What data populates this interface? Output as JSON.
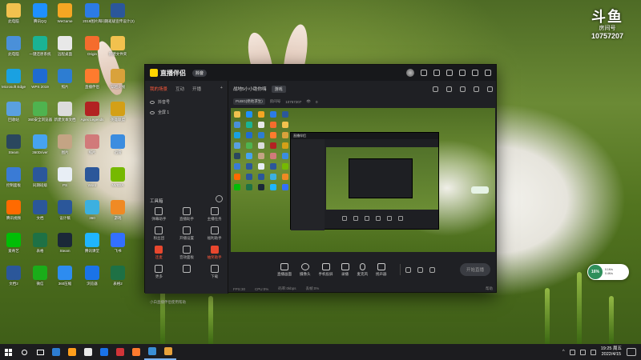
{
  "watermark": {
    "logo": "斗鱼",
    "sub": "房间号",
    "room": "10757207"
  },
  "desktop_icons": [
    {
      "label": "此电脑",
      "color": "#f2c14e"
    },
    {
      "label": "腾讯QQ",
      "color": "#1e90ff"
    },
    {
      "label": "WeGame",
      "color": "#f5a623"
    },
    {
      "label": "2019图片库",
      "color": "#2c7be5"
    },
    {
      "label": "同期班级宣传设计(2)",
      "color": "#2b579a"
    },
    {
      "label": "此电脑",
      "color": "#4a90d9"
    },
    {
      "label": "一键还原系统",
      "color": "#1ab394"
    },
    {
      "label": "远程桌面",
      "color": "#e8e8e8"
    },
    {
      "label": "Origin",
      "color": "#f56c2d"
    },
    {
      "label": "新建文件夹",
      "color": "#f2c14e"
    },
    {
      "label": "Microsoft Edge",
      "color": "#1aa1e1"
    },
    {
      "label": "WPS 2019",
      "color": "#1f6bd1"
    },
    {
      "label": "照片",
      "color": "#2d7dd2"
    },
    {
      "label": "直播伴侣",
      "color": "#ff7b2e"
    },
    {
      "label": "穿越火线",
      "color": "#d9a23b"
    },
    {
      "label": "回收站",
      "color": "#5aa0e0"
    },
    {
      "label": "360安全浏览器",
      "color": "#4fb34f"
    },
    {
      "label": "新建文本文档",
      "color": "#dcdcdc"
    },
    {
      "label": "Apex Legends",
      "color": "#b22222"
    },
    {
      "label": "英雄联盟",
      "color": "#d4a017"
    },
    {
      "label": "Steam",
      "color": "#2a475e"
    },
    {
      "label": "360Driver",
      "color": "#46a3f0"
    },
    {
      "label": "图片",
      "color": "#c4a484"
    },
    {
      "label": "照片",
      "color": "#d17a7a"
    },
    {
      "label": "迅雷",
      "color": "#3b8de0"
    },
    {
      "label": "控制面板",
      "color": "#3a7bd5"
    },
    {
      "label": "同期班级",
      "color": "#2b579a"
    },
    {
      "label": "PS",
      "color": "#e8eef5"
    },
    {
      "label": "Word",
      "color": "#2b579a"
    },
    {
      "label": "NVIDIA",
      "color": "#76b900"
    },
    {
      "label": "腾讯视频",
      "color": "#ff6a00"
    },
    {
      "label": "文档",
      "color": "#2b579a"
    },
    {
      "label": "设计稿",
      "color": "#2b579a"
    },
    {
      "label": "360",
      "color": "#3cb0e0"
    },
    {
      "label": "游戏",
      "color": "#f08a24"
    },
    {
      "label": "爱奇艺",
      "color": "#00be06"
    },
    {
      "label": "表格",
      "color": "#1e7145"
    },
    {
      "label": "Steam",
      "color": "#1b2838"
    },
    {
      "label": "腾讯课堂",
      "color": "#1fb5ff"
    },
    {
      "label": "飞书",
      "color": "#3370ff"
    },
    {
      "label": "文档2",
      "color": "#2b579a"
    },
    {
      "label": "微信",
      "color": "#1aad19"
    },
    {
      "label": "360压缩",
      "color": "#2d8cf0"
    },
    {
      "label": "浏览器",
      "color": "#1a73e8"
    },
    {
      "label": "表格2",
      "color": "#1e7145"
    }
  ],
  "app": {
    "title": "直播伴侣",
    "badge": "抖音",
    "tabs": [
      "我的场景",
      "互动",
      "开播"
    ],
    "tab_plus": "+",
    "scenes": [
      "抖音号",
      "全屏 1"
    ],
    "toolbox_title": "工具箱",
    "tools": [
      {
        "label": "弹幕助手",
        "red": false
      },
      {
        "label": "直播助手",
        "red": false
      },
      {
        "label": "主播任务",
        "red": false
      },
      {
        "label": "粉丝团",
        "red": false
      },
      {
        "label": "开播设置",
        "red": false
      },
      {
        "label": "福利助手",
        "red": false
      },
      {
        "label": "连麦",
        "red": true
      },
      {
        "label": "音效面板",
        "red": false
      },
      {
        "label": "抽奖助手",
        "red": true
      },
      {
        "label": "更多",
        "red": false
      },
      {
        "label": "",
        "red": false
      },
      {
        "label": "下载",
        "red": false
      }
    ],
    "help": "小白直播伴侣使用帮助",
    "stream_title": "战地5小小助你嗨",
    "stream_tag": "游戏",
    "category": "PUBG(绝地求生)",
    "room_label": "房间号",
    "room_id": "10757207",
    "viewers": "0",
    "controls": [
      "直播画面",
      "摄像头",
      "手机投屏",
      "录播",
      "麦克风",
      "扬声器"
    ],
    "start_label": "开始直播",
    "status": [
      "FPS:30",
      "CPU:0%",
      "码率:0kbps",
      "丢帧:0%"
    ],
    "status_right": "帮助"
  },
  "float_widget": {
    "pct": "16%",
    "up": "0.1K/s",
    "down": "0.4K/s"
  },
  "taskbar": {
    "time": "19:25 周五",
    "date": "2022/4/15",
    "apps": [
      "#2d7dd2",
      "#ff9f1c",
      "#e8e8e8",
      "#1a73e8",
      "#d13438",
      "#ff7b2e",
      "#3a8fd6",
      "#e8a23b"
    ]
  }
}
